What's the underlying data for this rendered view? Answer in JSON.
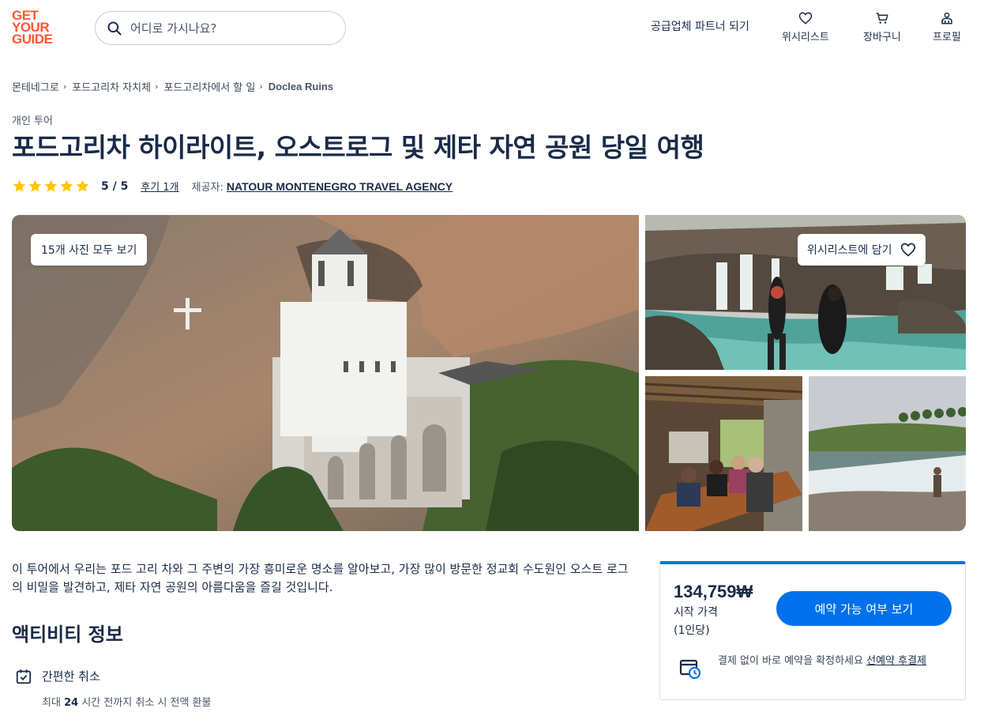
{
  "header": {
    "logo_lines": [
      "GET",
      "YOUR",
      "GUIDE"
    ],
    "search_placeholder": "어디로 가시나요?",
    "partner_link": "공급업체 파트너 되기",
    "nav": {
      "wishlist": "위시리스트",
      "cart": "장바구니",
      "profile": "프로필"
    }
  },
  "breadcrumb": [
    "몬테네그로",
    "포드고리차 자치체",
    "포드고리차에서 할 일",
    "Doclea Ruins"
  ],
  "tour": {
    "category": "개인 투어",
    "title": "포드고리차 하이라이트, 오스트로그 및 제타 자연 공원 당일 여행",
    "rating_score": "5 / 5",
    "rating_value": 5,
    "reviews_link": "후기 1개",
    "provider_label": "제공자:",
    "provider_name": "NATOUR MONTENEGRO TRAVEL AGENCY"
  },
  "gallery": {
    "all_photos_button": "15개 사진 모두 보기",
    "wishlist_button": "위시리스트에 담기"
  },
  "description": "이 투어에서 우리는 포드 고리 차와 그 주변의 가장 흥미로운 명소를 알아보고, 가장 많이 방문한 정교회 수도원인 오스트 로그의 비밀을 발견하고, 제타 자연 공원의 아름다움을 즐길 것입니다.",
  "activity_info": {
    "heading": "액티비티 정보",
    "cancel_title": "간편한 취소",
    "cancel_sub_prefix": "최대",
    "cancel_sub_hours": "24",
    "cancel_sub_suffix": "시간 전까지 취소 시 전액 환불"
  },
  "booking": {
    "price": "134,759₩",
    "from_label": "시작 가격",
    "per_person": "(1인당)",
    "cta": "예약 가능 여부 보기",
    "pay_text": "결제 없이 바로 예약을 확정하세요",
    "pay_link": "선예약 후결제"
  },
  "colors": {
    "brand": "#ff5533",
    "primary": "#0071eb",
    "text": "#1a2b49",
    "star": "#ffc600"
  }
}
